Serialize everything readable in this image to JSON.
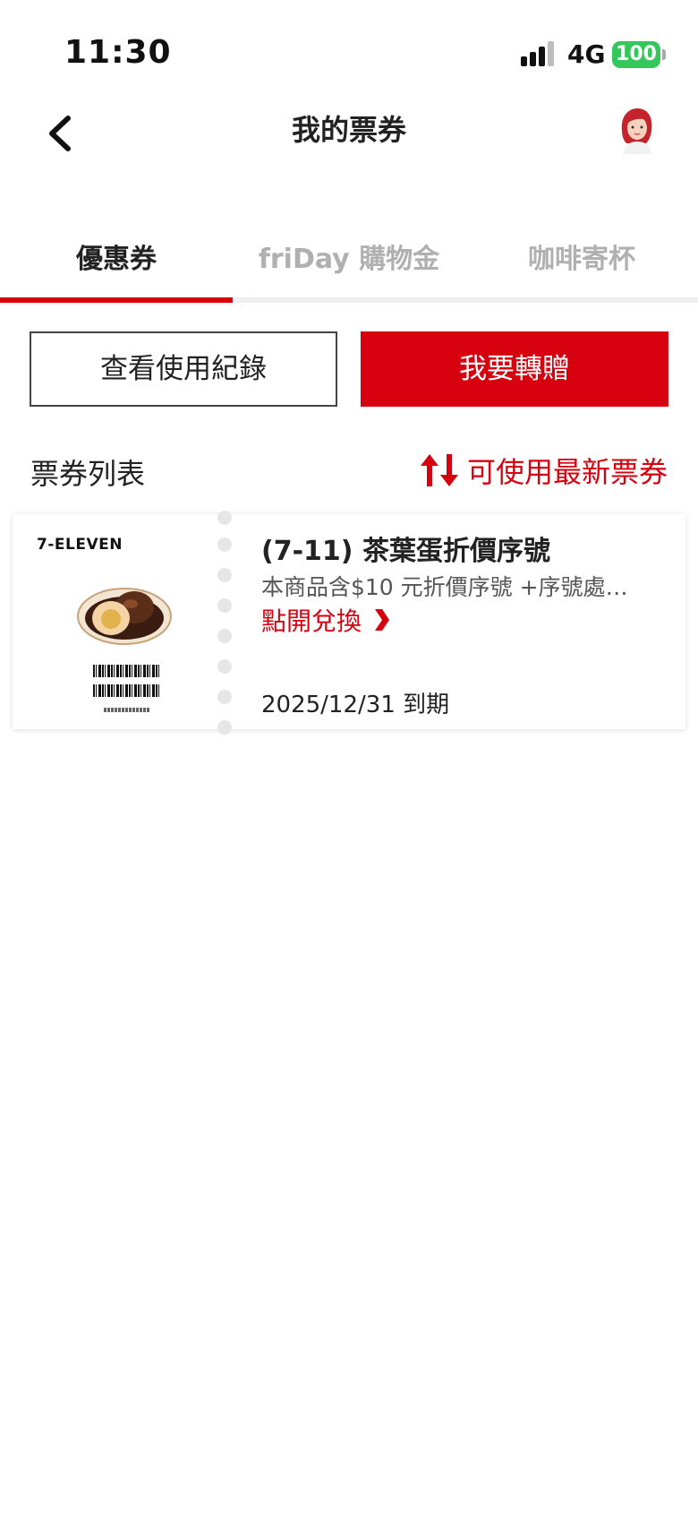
{
  "status_bar": {
    "time": "11:30",
    "network": "4G",
    "battery": "100",
    "battery_color": "#34c759"
  },
  "header": {
    "title": "我的票券",
    "back_icon": "chevron-left-icon",
    "avatar_icon": "user-avatar-icon"
  },
  "tabs": [
    {
      "label": "優惠券",
      "active": true
    },
    {
      "label": "friDay 購物金",
      "active": false
    },
    {
      "label": "咖啡寄杯",
      "active": false
    }
  ],
  "actions": {
    "history_label": "查看使用紀錄",
    "transfer_label": "我要轉贈"
  },
  "list": {
    "title": "票券列表",
    "sort_label": "可使用最新票券",
    "sort_icon": "sort-arrows-icon"
  },
  "coupons": [
    {
      "brand": "7-ELEVEN",
      "title": "(7-11) 茶葉蛋折價序號",
      "description": "本商品含$10 元折價序號 +序號處理費...",
      "redeem_label": "點開兌換",
      "expiry": "2025/12/31 到期"
    }
  ],
  "colors": {
    "accent": "#d7000f",
    "inactive_tab": "#b0b0b0",
    "text": "#222222"
  }
}
